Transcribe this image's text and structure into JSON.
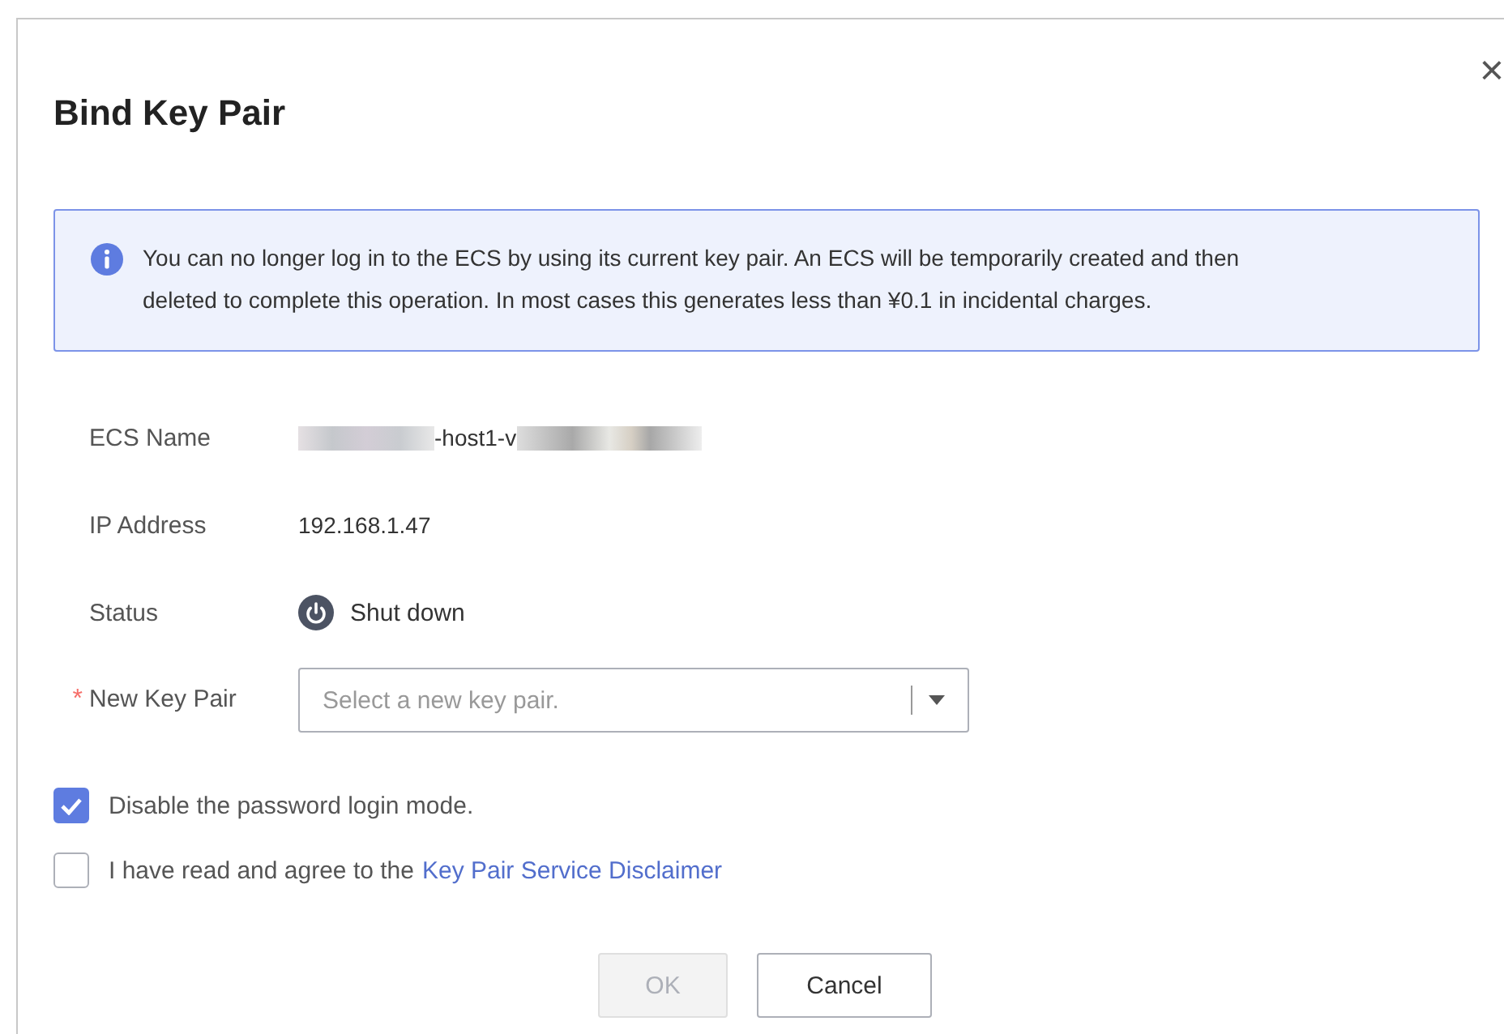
{
  "dialog": {
    "title": "Bind Key Pair",
    "close": "×"
  },
  "alert": {
    "text": "You can no longer log in to the ECS by using its current key pair. An ECS will be temporarily created and then deleted to complete this operation. In most cases this generates less than ¥0.1 in incidental charges."
  },
  "fields": [
    {
      "kind": "masked",
      "label": "ECS Name",
      "value": "-host1-v"
    },
    {
      "kind": "text",
      "label": "IP Address",
      "value": "192.168.1.47"
    },
    {
      "kind": "status",
      "label": "Status",
      "value": "Shut down"
    },
    {
      "kind": "select",
      "label": "New Key Pair",
      "required_mark": "*",
      "placeholder": "Select a new key pair."
    }
  ],
  "options": [
    {
      "label": "Disable the password login mode.",
      "checked": true
    },
    {
      "label": "I have read and agree to the",
      "link": "Key Pair Service Disclaimer",
      "checked": false
    }
  ],
  "buttons": [
    {
      "label": "OK",
      "disabled": true
    },
    {
      "label": "Cancel",
      "disabled": false
    }
  ]
}
